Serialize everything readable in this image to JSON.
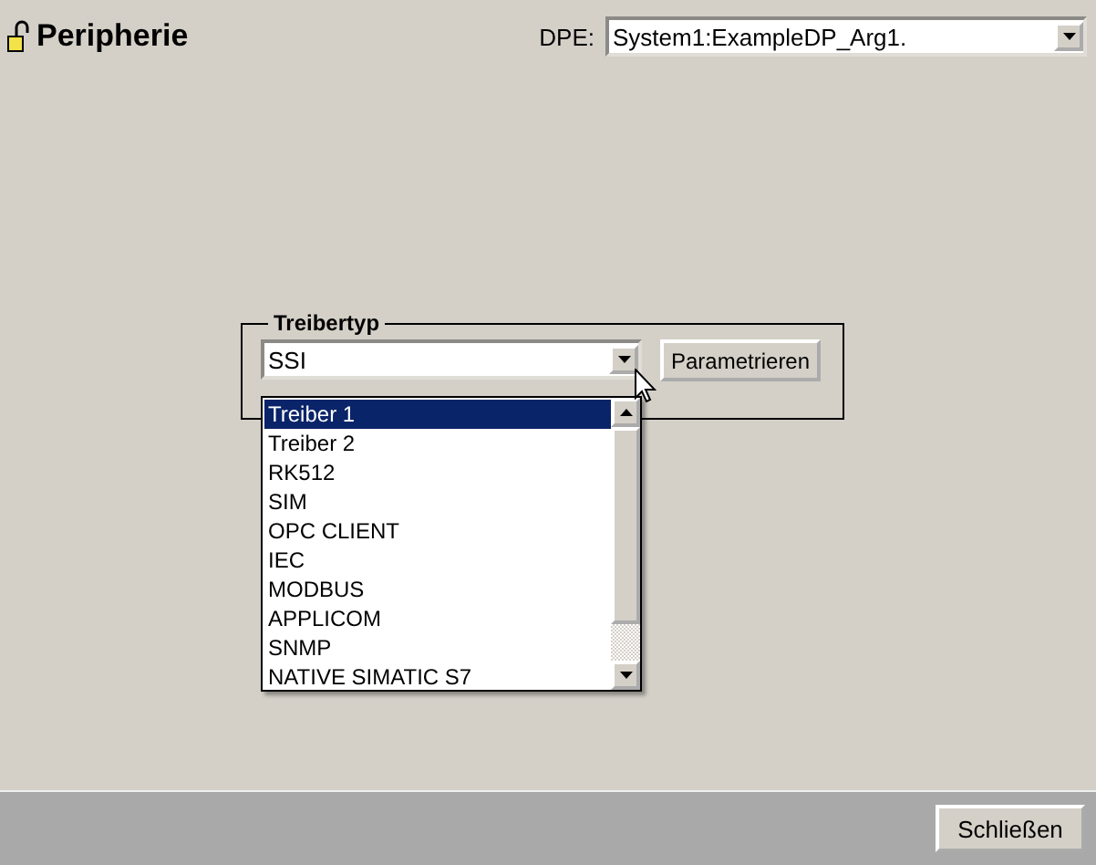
{
  "title": "Peripherie",
  "dpe": {
    "label": "DPE:",
    "value": "System1:ExampleDP_Arg1."
  },
  "driver_group": {
    "legend": "Treibertyp",
    "value": "SSI",
    "button": "Parametrieren",
    "options": [
      {
        "label": "Treiber 1",
        "selected": true
      },
      {
        "label": "Treiber 2",
        "selected": false
      },
      {
        "label": "RK512",
        "selected": false
      },
      {
        "label": "SIM",
        "selected": false
      },
      {
        "label": "OPC CLIENT",
        "selected": false
      },
      {
        "label": "IEC",
        "selected": false
      },
      {
        "label": "MODBUS",
        "selected": false
      },
      {
        "label": "APPLICOM",
        "selected": false
      },
      {
        "label": "SNMP",
        "selected": false
      },
      {
        "label": "NATIVE SIMATIC S7",
        "selected": false
      }
    ]
  },
  "close_button": "Schließen"
}
